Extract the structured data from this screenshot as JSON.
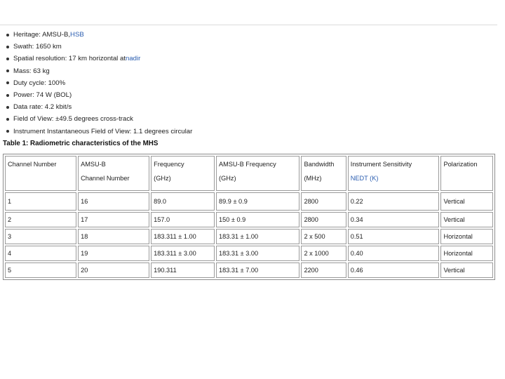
{
  "specs": [
    {
      "text": "Heritage: AMSU-B, ",
      "link": "HSB"
    },
    {
      "text": "Swath: 1650 km",
      "link": ""
    },
    {
      "text": "Spatial resolution: 17 km horizontal at ",
      "link": "nadir"
    },
    {
      "text": "Mass: 63 kg",
      "link": ""
    },
    {
      "text": "Duty cycle: 100%",
      "link": ""
    },
    {
      "text": "Power: 74 W (BOL)",
      "link": ""
    },
    {
      "text": "Data rate: 4.2 kbit/s",
      "link": ""
    },
    {
      "text": "Field of View: ±49.5 degrees cross-track",
      "link": ""
    },
    {
      "text": "Instrument Instantaneous Field of View: 1.1 degrees circular",
      "link": ""
    }
  ],
  "table": {
    "caption": "Table 1: Radiometric characteristics of the MHS",
    "headers": [
      {
        "line1": "Channel Number",
        "line2": ""
      },
      {
        "line1": "AMSU-B",
        "line2": "Channel Number"
      },
      {
        "line1": "Frequency",
        "line2": "(GHz)"
      },
      {
        "line1": "AMSU-B Frequency",
        "line2": "(GHz)"
      },
      {
        "line1": "Bandwidth",
        "line2": "(MHz)"
      },
      {
        "line1": "Instrument Sensitivity",
        "line2": "NEDT (K)"
      },
      {
        "line1": "Polarization",
        "line2": ""
      }
    ],
    "rows": [
      [
        "1",
        "16",
        "89.0",
        "89.9 ± 0.9",
        "2800",
        "0.22",
        "Vertical"
      ],
      [
        "2",
        "17",
        "157.0",
        "150 ± 0.9",
        "2800",
        "0.34",
        "Vertical"
      ],
      [
        "3",
        "18",
        "183.311 ± 1.00",
        "183.31 ± 1.00",
        "2 x 500",
        "0.51",
        "Horizontal"
      ],
      [
        "4",
        "19",
        "183.311 ± 3.00",
        "183.31 ± 3.00",
        "2 x 1000",
        "0.40",
        "Horizontal"
      ],
      [
        "5",
        "20",
        "190.311",
        "183.31 ± 7.00",
        "2200",
        "0.46",
        "Vertical"
      ]
    ]
  }
}
